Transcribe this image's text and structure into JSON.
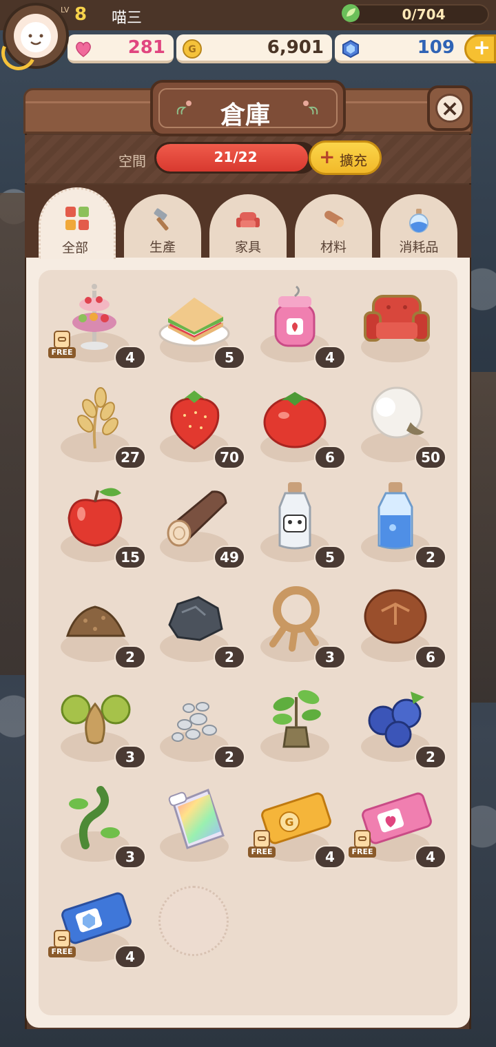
{
  "player": {
    "level_prefix": "LV",
    "level": "8",
    "name": "喵三",
    "exp": "0/704"
  },
  "resources": {
    "hearts": "281",
    "gold": "6,901",
    "gems": "109"
  },
  "panel": {
    "title": "倉庫",
    "space_label": "空間",
    "capacity": "21/22",
    "capacity_fraction": 0.9545,
    "expand_label": "擴充"
  },
  "tabs": [
    {
      "label": "全部",
      "icon": "grid-icon",
      "active": true
    },
    {
      "label": "生產",
      "icon": "hammer-icon"
    },
    {
      "label": "家具",
      "icon": "armchair-icon"
    },
    {
      "label": "材料",
      "icon": "log-icon"
    },
    {
      "label": "消耗品",
      "icon": "potion-icon"
    }
  ],
  "free_label": "FREE",
  "items": [
    {
      "icon": "dessert-stand-icon",
      "qty": "4",
      "free": true
    },
    {
      "icon": "sandwich-icon",
      "qty": "5"
    },
    {
      "icon": "strawberry-jam-icon",
      "qty": "4"
    },
    {
      "icon": "red-sofa-icon",
      "qty": ""
    },
    {
      "icon": "wheat-icon",
      "qty": "27"
    },
    {
      "icon": "strawberry-icon",
      "qty": "70"
    },
    {
      "icon": "tomato-icon",
      "qty": "6"
    },
    {
      "icon": "cotton-icon",
      "qty": "50"
    },
    {
      "icon": "apple-icon",
      "qty": "15"
    },
    {
      "icon": "wood-log-icon",
      "qty": "49"
    },
    {
      "icon": "milk-bottle-icon",
      "qty": "5"
    },
    {
      "icon": "water-bottle-icon",
      "qty": "2"
    },
    {
      "icon": "soil-pile-icon",
      "qty": "2"
    },
    {
      "icon": "coal-icon",
      "qty": "2"
    },
    {
      "icon": "rope-icon",
      "qty": "3"
    },
    {
      "icon": "bread-icon",
      "qty": "6"
    },
    {
      "icon": "onion-icon",
      "qty": "3"
    },
    {
      "icon": "pebbles-icon",
      "qty": "2"
    },
    {
      "icon": "sapling-icon",
      "qty": ""
    },
    {
      "icon": "blueberry-icon",
      "qty": "2"
    },
    {
      "icon": "vine-icon",
      "qty": "3"
    },
    {
      "icon": "rainbow-bag-icon",
      "qty": ""
    },
    {
      "icon": "gold-ticket-icon",
      "qty": "4",
      "free": true
    },
    {
      "icon": "heart-ticket-icon",
      "qty": "4",
      "free": true
    },
    {
      "icon": "gem-ticket-icon",
      "qty": "4",
      "free": true
    }
  ]
}
